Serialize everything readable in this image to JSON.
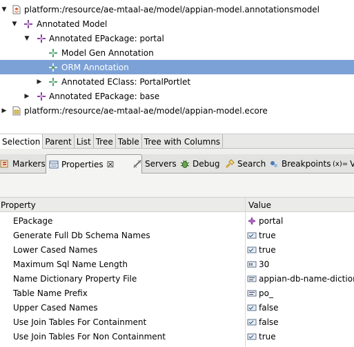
{
  "tree": {
    "nodes": [
      {
        "label": "platform:/resource/ae-mtaal-ae/model/appian-model.annotationsmodel",
        "icon": "annotations-file-icon",
        "twisty": "expanded"
      },
      {
        "label": "Annotated Model",
        "icon": "annotated-model-icon",
        "twisty": "expanded"
      },
      {
        "label": "Annotated EPackage: portal",
        "icon": "annotated-epackage-icon",
        "twisty": "expanded"
      },
      {
        "label": "Model Gen Annotation",
        "icon": "annotation-icon",
        "twisty": "none"
      },
      {
        "label": "ORM Annotation",
        "icon": "annotation-icon",
        "twisty": "none",
        "selected": true
      },
      {
        "label": "Annotated EClass: PortalPortlet",
        "icon": "annotated-eclass-icon",
        "twisty": "collapsed"
      },
      {
        "label": "Annotated EPackage: base",
        "icon": "annotated-epackage-icon",
        "twisty": "collapsed"
      },
      {
        "label": "platform:/resource/ae-mtaal-ae/model/appian-model.ecore",
        "icon": "ecore-file-icon",
        "twisty": "collapsed"
      }
    ]
  },
  "editor_tabs": [
    "Selection",
    "Parent",
    "List",
    "Tree",
    "Table",
    "Tree with Columns"
  ],
  "view_tabs": {
    "markers": "Markers",
    "properties": "Properties",
    "properties_close": "☒",
    "servers": "Servers",
    "debug": "Debug",
    "search": "Search",
    "breakpoints": "Breakpoints",
    "variables": "V"
  },
  "properties": {
    "header_property": "Property",
    "header_value": "Value",
    "rows": [
      {
        "name": "EPackage",
        "value": "portal",
        "icon": "epackage-icon"
      },
      {
        "name": "Generate Full Db Schema Names",
        "value": "true",
        "icon": "boolean-icon"
      },
      {
        "name": "Lower Cased Names",
        "value": "true",
        "icon": "boolean-icon"
      },
      {
        "name": "Maximum Sql Name Length",
        "value": "30",
        "icon": "number-icon"
      },
      {
        "name": "Name Dictionary Property File",
        "value": "appian-db-name-dictionar",
        "icon": "text-icon"
      },
      {
        "name": "Table Name Prefix",
        "value": "po_",
        "icon": "text-icon"
      },
      {
        "name": "Upper Cased Names",
        "value": "false",
        "icon": "boolean-icon"
      },
      {
        "name": "Use Join Tables For Containment",
        "value": "false",
        "icon": "boolean-icon"
      },
      {
        "name": "Use Join Tables For Non Containment",
        "value": "true",
        "icon": "boolean-icon"
      }
    ]
  },
  "colors": {
    "selection": "#7ca1d6",
    "annotation_green": "#4a9e6a",
    "epackage_purple": "#8a3fa0"
  }
}
